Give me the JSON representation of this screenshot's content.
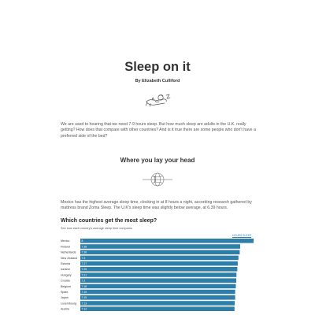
{
  "article": {
    "title": "Sleep on it",
    "byline": "By Elizabeth Culliford",
    "intro": "We are used to hearing that we need 7-9 hours sleep. But how much sleep are adults in the U.K. really getting? How does that compare with other countries? And is it true there are some people who don't have a preferred side of the bed?",
    "section_heading": "Where you lay your head",
    "paragraph2": "Mexico has the highest average sleep time, clocking in at 8 hours a night, according research gathered by mattress brand Zoma Sleep. The U.K's sleep time was slightly below average, at 6.39 hours."
  },
  "icons": {
    "sleep": "sleeping-person-icon",
    "globe": "globe-icon"
  },
  "colors": {
    "bar": "#2e7eaa",
    "bar_label": "#ffffff",
    "legend": "#2e7eaa"
  },
  "chart_data": {
    "type": "bar",
    "orientation": "horizontal",
    "title": "Which countries get the most sleep?",
    "subtitle": "See how each country's average sleep time compares",
    "legend_label": "HOURS SLEEP",
    "categories": [
      "Mexico",
      "Finland",
      "Netherlands",
      "New Zealand",
      "Estonia",
      "Iceland",
      "Hungary",
      "Croatia",
      "Belgium",
      "Spain",
      "Japan",
      "Luxembourg",
      "Austria"
    ],
    "series": [
      {
        "name": "HOURS SLEEP",
        "values": [
          8,
          7.38,
          7.36,
          7.3,
          7.27,
          7.25,
          7.21,
          7.2,
          7.18,
          7.15,
          7.15,
          7.13,
          7.12
        ],
        "labels": [
          "8",
          "7.38",
          "7.36",
          "7.3",
          "7.27",
          "7.25",
          "7.21",
          "7.2",
          "7.18",
          "7.15",
          "7.15",
          "7.13",
          "7.12"
        ]
      }
    ],
    "xlim": [
      0,
      8
    ]
  }
}
